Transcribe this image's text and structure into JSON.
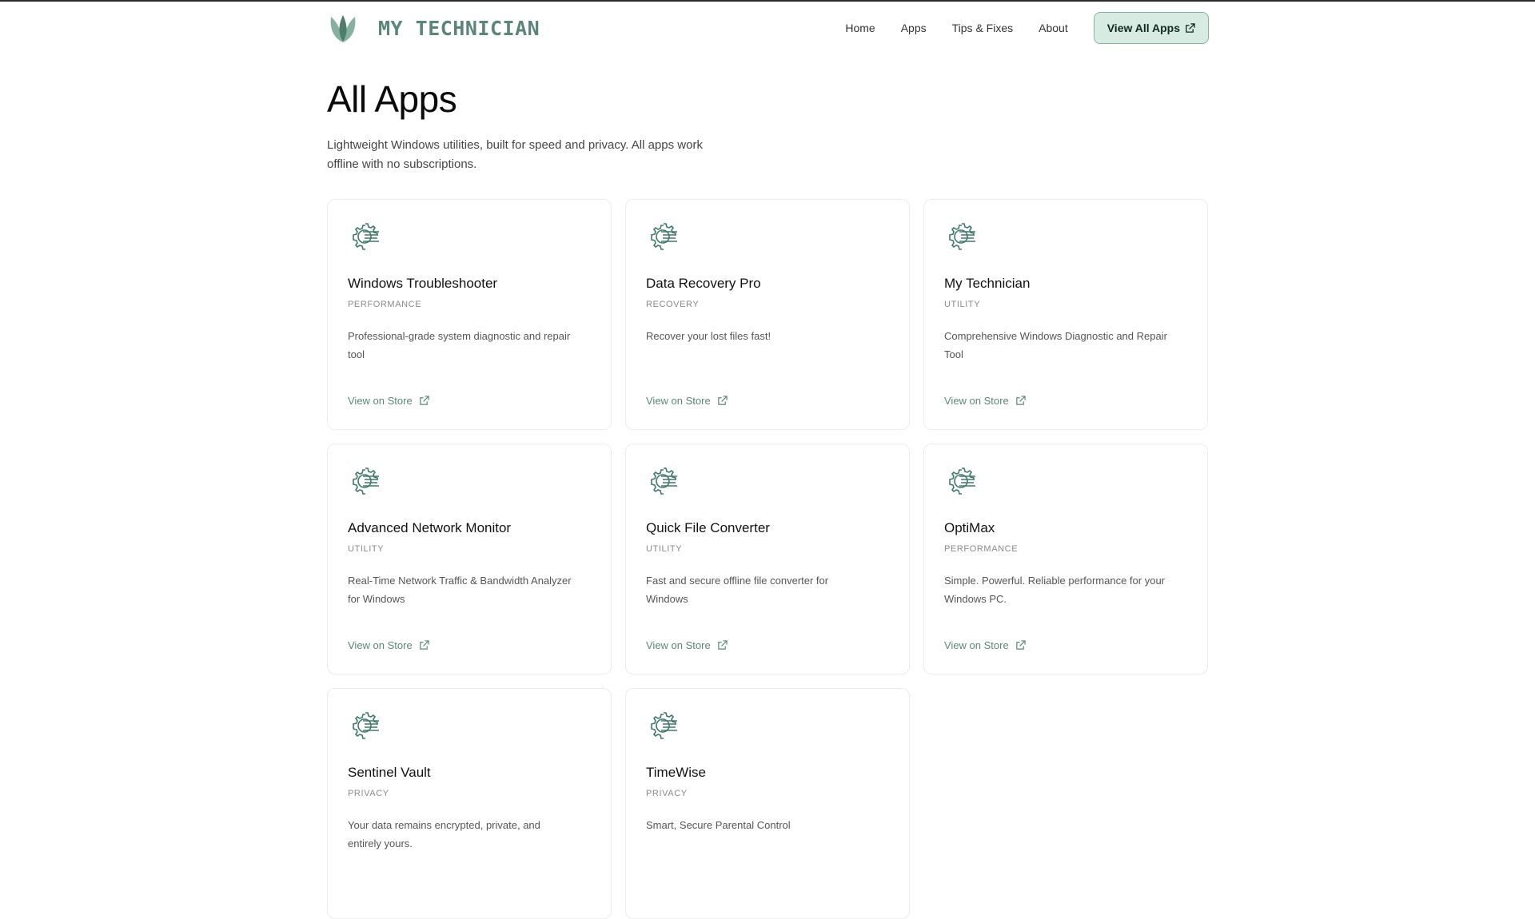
{
  "brand": {
    "name": "MY TECHNICIAN",
    "logo_icon": "leaf-icon",
    "color": "#5b8676"
  },
  "nav": {
    "links": [
      "Home",
      "Apps",
      "Tips & Fixes",
      "About"
    ],
    "cta_label": "View All Apps",
    "cta_icon": "external-link-icon",
    "cta_bg": "#d7ebe2"
  },
  "hero": {
    "title": "All Apps",
    "subtitle_line1": "Lightweight Windows utilities, built for speed and privacy. All apps work",
    "subtitle_line2": "offline with no subscriptions."
  },
  "apps": [
    {
      "title": "Windows Troubleshooter",
      "category": "PERFORMANCE",
      "desc_line1": "Professional-grade system diagnostic and repair",
      "desc_line2": "tool",
      "link": "View on Store",
      "icon": "gear-lines-icon"
    },
    {
      "title": "Data Recovery Pro",
      "category": "RECOVERY",
      "desc_line1": "Recover your lost files fast!",
      "desc_line2": "",
      "link": "View on Store",
      "icon": "gear-lines-icon"
    },
    {
      "title": "My Technician",
      "category": "UTILITY",
      "desc_line1": "Comprehensive Windows Diagnostic and Repair",
      "desc_line2": "Tool",
      "link": "View on Store",
      "icon": "gear-lines-icon"
    },
    {
      "title": "Advanced Network Monitor",
      "category": "UTILITY",
      "desc_line1": "Real-Time Network Traffic & Bandwidth Analyzer",
      "desc_line2": "for Windows",
      "link": "View on Store",
      "icon": "gear-lines-icon"
    },
    {
      "title": "Quick File Converter",
      "category": "UTILITY",
      "desc_line1": "Fast and secure offline file converter for",
      "desc_line2": "Windows",
      "link": "View on Store",
      "icon": "gear-lines-icon"
    },
    {
      "title": "OptiMax",
      "category": "PERFORMANCE",
      "desc_line1": "Simple. Powerful. Reliable performance for your",
      "desc_line2": "Windows PC.",
      "link": "View on Store",
      "icon": "gear-lines-icon"
    },
    {
      "title": "Sentinel Vault",
      "category": "PRIVACY",
      "desc_line1": "Your data remains encrypted, private, and",
      "desc_line2": "entirely yours.",
      "link": "",
      "icon": "gear-lines-icon"
    },
    {
      "title": "TimeWise",
      "category": "PRIVACY",
      "desc_line1": "Smart, Secure Parental Control",
      "desc_line2": "",
      "link": "",
      "icon": "gear-lines-icon"
    }
  ]
}
